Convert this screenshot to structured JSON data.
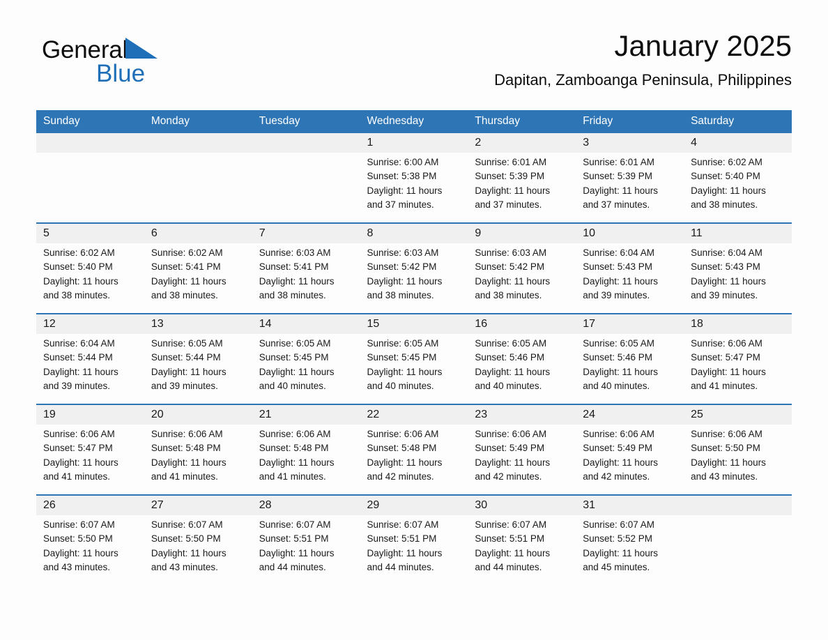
{
  "brand": {
    "word1": "General",
    "word2": "Blue",
    "flag_icon": "blue-triangle-flag-icon",
    "accent_color": "#1f6fb8"
  },
  "header": {
    "title": "January 2025",
    "location": "Dapitan, Zamboanga Peninsula, Philippines"
  },
  "theme": {
    "header_blue": "#2e75b6",
    "daynum_band": "#f0f0f0",
    "cell_background": "#fdfdfd",
    "text": "#1a1a1a"
  },
  "weekday_headers": [
    "Sunday",
    "Monday",
    "Tuesday",
    "Wednesday",
    "Thursday",
    "Friday",
    "Saturday"
  ],
  "weeks": [
    {
      "days": [
        {
          "num": "",
          "sunrise": "",
          "sunset": "",
          "daylight": ""
        },
        {
          "num": "",
          "sunrise": "",
          "sunset": "",
          "daylight": ""
        },
        {
          "num": "",
          "sunrise": "",
          "sunset": "",
          "daylight": ""
        },
        {
          "num": "1",
          "sunrise": "Sunrise: 6:00 AM",
          "sunset": "Sunset: 5:38 PM",
          "daylight": "Daylight: 11 hours and 37 minutes."
        },
        {
          "num": "2",
          "sunrise": "Sunrise: 6:01 AM",
          "sunset": "Sunset: 5:39 PM",
          "daylight": "Daylight: 11 hours and 37 minutes."
        },
        {
          "num": "3",
          "sunrise": "Sunrise: 6:01 AM",
          "sunset": "Sunset: 5:39 PM",
          "daylight": "Daylight: 11 hours and 37 minutes."
        },
        {
          "num": "4",
          "sunrise": "Sunrise: 6:02 AM",
          "sunset": "Sunset: 5:40 PM",
          "daylight": "Daylight: 11 hours and 38 minutes."
        }
      ]
    },
    {
      "days": [
        {
          "num": "5",
          "sunrise": "Sunrise: 6:02 AM",
          "sunset": "Sunset: 5:40 PM",
          "daylight": "Daylight: 11 hours and 38 minutes."
        },
        {
          "num": "6",
          "sunrise": "Sunrise: 6:02 AM",
          "sunset": "Sunset: 5:41 PM",
          "daylight": "Daylight: 11 hours and 38 minutes."
        },
        {
          "num": "7",
          "sunrise": "Sunrise: 6:03 AM",
          "sunset": "Sunset: 5:41 PM",
          "daylight": "Daylight: 11 hours and 38 minutes."
        },
        {
          "num": "8",
          "sunrise": "Sunrise: 6:03 AM",
          "sunset": "Sunset: 5:42 PM",
          "daylight": "Daylight: 11 hours and 38 minutes."
        },
        {
          "num": "9",
          "sunrise": "Sunrise: 6:03 AM",
          "sunset": "Sunset: 5:42 PM",
          "daylight": "Daylight: 11 hours and 38 minutes."
        },
        {
          "num": "10",
          "sunrise": "Sunrise: 6:04 AM",
          "sunset": "Sunset: 5:43 PM",
          "daylight": "Daylight: 11 hours and 39 minutes."
        },
        {
          "num": "11",
          "sunrise": "Sunrise: 6:04 AM",
          "sunset": "Sunset: 5:43 PM",
          "daylight": "Daylight: 11 hours and 39 minutes."
        }
      ]
    },
    {
      "days": [
        {
          "num": "12",
          "sunrise": "Sunrise: 6:04 AM",
          "sunset": "Sunset: 5:44 PM",
          "daylight": "Daylight: 11 hours and 39 minutes."
        },
        {
          "num": "13",
          "sunrise": "Sunrise: 6:05 AM",
          "sunset": "Sunset: 5:44 PM",
          "daylight": "Daylight: 11 hours and 39 minutes."
        },
        {
          "num": "14",
          "sunrise": "Sunrise: 6:05 AM",
          "sunset": "Sunset: 5:45 PM",
          "daylight": "Daylight: 11 hours and 40 minutes."
        },
        {
          "num": "15",
          "sunrise": "Sunrise: 6:05 AM",
          "sunset": "Sunset: 5:45 PM",
          "daylight": "Daylight: 11 hours and 40 minutes."
        },
        {
          "num": "16",
          "sunrise": "Sunrise: 6:05 AM",
          "sunset": "Sunset: 5:46 PM",
          "daylight": "Daylight: 11 hours and 40 minutes."
        },
        {
          "num": "17",
          "sunrise": "Sunrise: 6:05 AM",
          "sunset": "Sunset: 5:46 PM",
          "daylight": "Daylight: 11 hours and 40 minutes."
        },
        {
          "num": "18",
          "sunrise": "Sunrise: 6:06 AM",
          "sunset": "Sunset: 5:47 PM",
          "daylight": "Daylight: 11 hours and 41 minutes."
        }
      ]
    },
    {
      "days": [
        {
          "num": "19",
          "sunrise": "Sunrise: 6:06 AM",
          "sunset": "Sunset: 5:47 PM",
          "daylight": "Daylight: 11 hours and 41 minutes."
        },
        {
          "num": "20",
          "sunrise": "Sunrise: 6:06 AM",
          "sunset": "Sunset: 5:48 PM",
          "daylight": "Daylight: 11 hours and 41 minutes."
        },
        {
          "num": "21",
          "sunrise": "Sunrise: 6:06 AM",
          "sunset": "Sunset: 5:48 PM",
          "daylight": "Daylight: 11 hours and 41 minutes."
        },
        {
          "num": "22",
          "sunrise": "Sunrise: 6:06 AM",
          "sunset": "Sunset: 5:48 PM",
          "daylight": "Daylight: 11 hours and 42 minutes."
        },
        {
          "num": "23",
          "sunrise": "Sunrise: 6:06 AM",
          "sunset": "Sunset: 5:49 PM",
          "daylight": "Daylight: 11 hours and 42 minutes."
        },
        {
          "num": "24",
          "sunrise": "Sunrise: 6:06 AM",
          "sunset": "Sunset: 5:49 PM",
          "daylight": "Daylight: 11 hours and 42 minutes."
        },
        {
          "num": "25",
          "sunrise": "Sunrise: 6:06 AM",
          "sunset": "Sunset: 5:50 PM",
          "daylight": "Daylight: 11 hours and 43 minutes."
        }
      ]
    },
    {
      "days": [
        {
          "num": "26",
          "sunrise": "Sunrise: 6:07 AM",
          "sunset": "Sunset: 5:50 PM",
          "daylight": "Daylight: 11 hours and 43 minutes."
        },
        {
          "num": "27",
          "sunrise": "Sunrise: 6:07 AM",
          "sunset": "Sunset: 5:50 PM",
          "daylight": "Daylight: 11 hours and 43 minutes."
        },
        {
          "num": "28",
          "sunrise": "Sunrise: 6:07 AM",
          "sunset": "Sunset: 5:51 PM",
          "daylight": "Daylight: 11 hours and 44 minutes."
        },
        {
          "num": "29",
          "sunrise": "Sunrise: 6:07 AM",
          "sunset": "Sunset: 5:51 PM",
          "daylight": "Daylight: 11 hours and 44 minutes."
        },
        {
          "num": "30",
          "sunrise": "Sunrise: 6:07 AM",
          "sunset": "Sunset: 5:51 PM",
          "daylight": "Daylight: 11 hours and 44 minutes."
        },
        {
          "num": "31",
          "sunrise": "Sunrise: 6:07 AM",
          "sunset": "Sunset: 5:52 PM",
          "daylight": "Daylight: 11 hours and 45 minutes."
        },
        {
          "num": "",
          "sunrise": "",
          "sunset": "",
          "daylight": ""
        }
      ]
    }
  ]
}
